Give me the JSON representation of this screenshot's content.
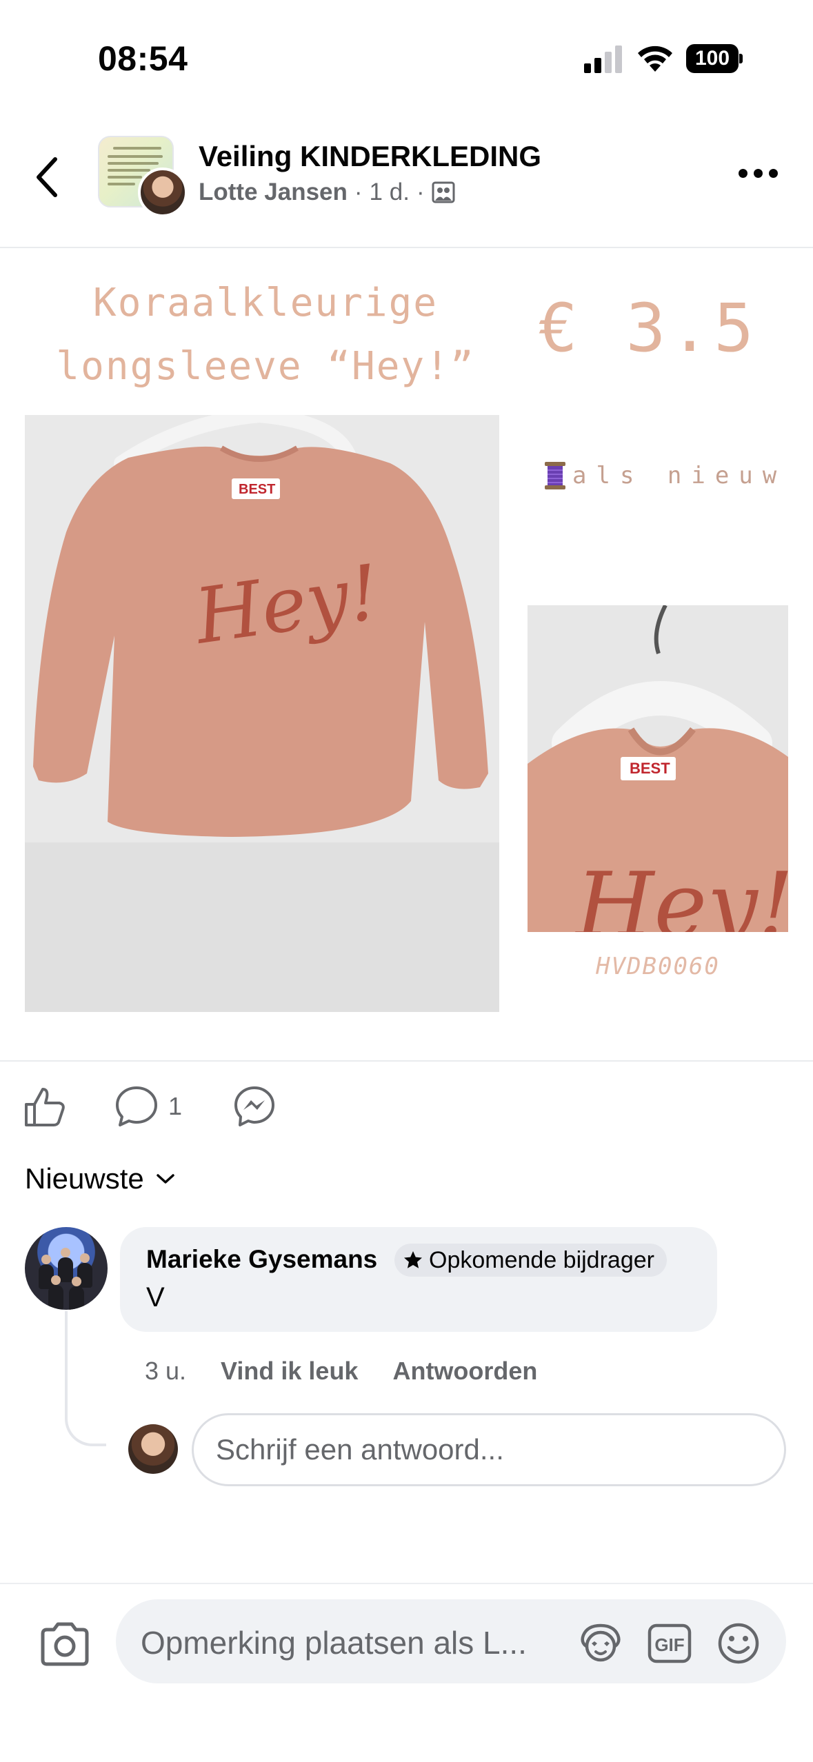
{
  "status_bar": {
    "time": "08:54",
    "battery": "100"
  },
  "header": {
    "group_name": "Veiling KINDERKLEDING",
    "author": "Lotte Jansen",
    "time_ago": "1 d.",
    "separator": "·"
  },
  "post_image": {
    "title_line1": "Koraalkleurige",
    "title_line2": "longsleeve “Hey!”",
    "price": "€ 3.5",
    "condition": "als nieuw",
    "code": "HVDB0060",
    "shirt_text": "Hey!",
    "brand_label": "BEST"
  },
  "actions": {
    "comment_count": "1"
  },
  "sort": {
    "label": "Nieuwste"
  },
  "comments": [
    {
      "author": "Marieke Gysemans",
      "badge": "Opkomende bijdrager",
      "text": "V",
      "time": "3 u.",
      "like_label": "Vind ik leuk",
      "reply_label": "Antwoorden"
    }
  ],
  "reply": {
    "placeholder": "Schrijf een antwoord..."
  },
  "composer": {
    "placeholder": "Opmerking plaatsen als L..."
  },
  "colors": {
    "accent_text": "#e2b49d",
    "shirt": "#d69a86",
    "muted": "#65676b"
  }
}
